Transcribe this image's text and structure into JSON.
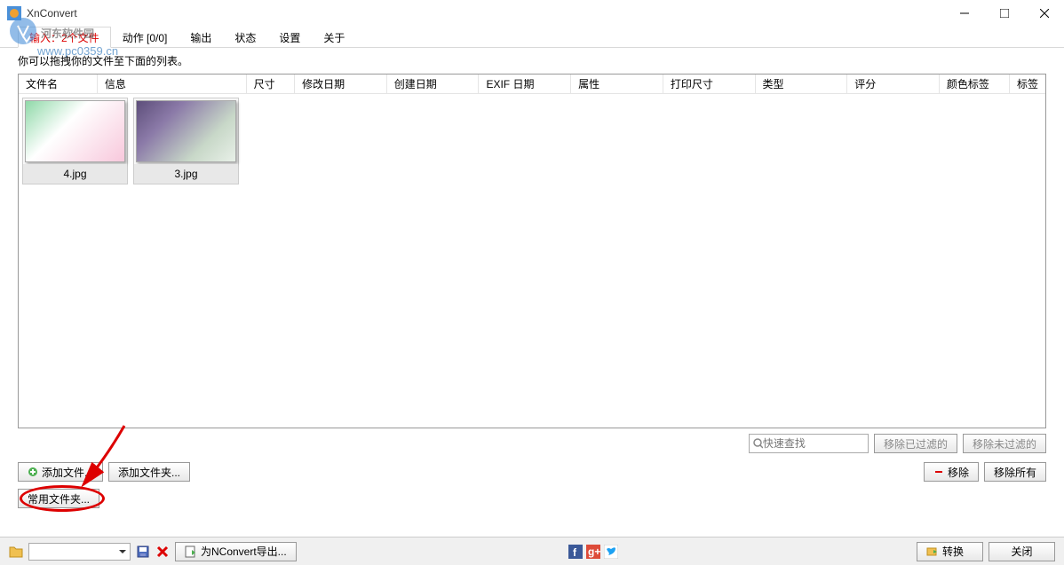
{
  "window": {
    "title": "XnConvert"
  },
  "watermark": {
    "text": "河东软件园",
    "sub": "www.pc0359.cn"
  },
  "tabs": {
    "input": "输入：2个文件",
    "actions": "动作 [0/0]",
    "output": "输出",
    "status": "状态",
    "settings": "设置",
    "about": "关于"
  },
  "hint": "你可以拖拽你的文件至下面的列表。",
  "columns": {
    "filename": "文件名",
    "info": "信息",
    "size": "尺寸",
    "modifyDate": "修改日期",
    "createDate": "创建日期",
    "exifDate": "EXIF 日期",
    "attributes": "属性",
    "printSize": "打印尺寸",
    "type": "类型",
    "rating": "评分",
    "colorLabel": "颜色标签",
    "label": "标签"
  },
  "files": {
    "file1": "4.jpg",
    "file2": "3.jpg"
  },
  "search": {
    "placeholder": "快速查找"
  },
  "buttons": {
    "removeFiltered": "移除已过滤的",
    "removeUnfiltered": "移除未过滤的",
    "addFiles": "添加文件...",
    "addFolder": "添加文件夹...",
    "remove": "移除",
    "removeAll": "移除所有",
    "commonFolders": "常用文件夹...",
    "exportNConvert": "为NConvert导出...",
    "convert": "转换",
    "close": "关闭"
  }
}
